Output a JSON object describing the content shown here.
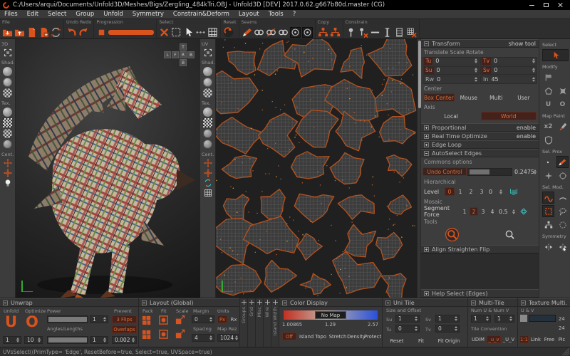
{
  "window": {
    "title": "C:/Users/arqui/Documents/Unfold3D/Meshes/Bigs/Zergling_484kTri.OBJ - Unfold3D [DEV] 2017.0.62.g667b80d.master (CG)"
  },
  "menu": {
    "items": [
      "Files",
      "Edit",
      "Select",
      "Group",
      "Unfold",
      "Symmetry",
      "Constrain&Deform",
      "Layout",
      "Tools",
      "?"
    ]
  },
  "toolbar": {
    "file": "File",
    "undo_redo": "Undo Redo",
    "progression": "Progression",
    "select": "Select",
    "reset": "Reset",
    "seams": "Seams",
    "copy": "Copy",
    "constrain": "Constrain"
  },
  "v3d": {
    "label": "3D",
    "shad": "Shad.",
    "tex": "Tex.",
    "cent": "Cent.",
    "nav": {
      "top": "T",
      "row": [
        "L",
        "F",
        "R",
        "B"
      ],
      "bottom": "B"
    }
  },
  "vuv": {
    "label": "UV",
    "shad": "Shad.",
    "tex": "Tex.",
    "cent": "Cent."
  },
  "rp": {
    "transform": {
      "title": "Transform",
      "show_tool": "show tool",
      "subtitle": "Translate Scale Rotate",
      "fields": [
        {
          "label": "Tu",
          "value": "0"
        },
        {
          "label": "Tv",
          "value": "0"
        },
        {
          "label": "Su",
          "value": "0"
        },
        {
          "label": "Sv",
          "value": "0"
        },
        {
          "label": "Rw",
          "value": "0"
        },
        {
          "label": "In",
          "value": "45"
        }
      ],
      "center_label": "Center",
      "center_options": [
        "Box Center",
        "Mouse",
        "Multi",
        "User"
      ],
      "axis_label": "Axis",
      "axis_options": [
        "Local",
        "World"
      ]
    },
    "sections": {
      "proportional": {
        "title": "Proportional",
        "right": "enable"
      },
      "rto": {
        "title": "Real Time Optimize",
        "right": "enable"
      },
      "edge_loop": {
        "title": "Edge Loop"
      },
      "autoselect": {
        "title": "AutoSelect Edges"
      }
    },
    "auto": {
      "commons": "Commons options",
      "undo_control": "Undo Control",
      "undo_value": "0.2475",
      "hierarchical": "Hierarchical",
      "level_label": "Level",
      "levels": [
        "0",
        "1",
        "2",
        "3"
      ],
      "level_value": "0",
      "mosaic": "Mosaic",
      "segment_label": "Segment Force",
      "segments": [
        "1",
        "2",
        "3",
        "4"
      ],
      "segment_value": "0.5",
      "tools": "Tools"
    },
    "align_title": "Align Straighten Flip",
    "help_title": "Help Select (Edges)"
  },
  "rs": {
    "select": "Select",
    "modify": "Modify",
    "map_paint": "Map Paint",
    "x2": "x2",
    "sel_prox": "Sel. Prox",
    "sel_mod": "Sel. Mod.",
    "symmetry": "Symmetry",
    "u": "U",
    "o": "O"
  },
  "bp": {
    "unwrap": {
      "title": "Unwrap",
      "unfold": "Unfold",
      "optimize": "Optimize",
      "power": "Power",
      "prevent": "Prevent",
      "angles": "Angles/Lengths",
      "u": "U",
      "o": "O",
      "unfold_value": "1",
      "optimize_value": "10",
      "power_value": "1",
      "angles_value": "1",
      "flips": "3 Flips",
      "overlaps": "Overlaps",
      "prevent_value": "0.002"
    },
    "layout": {
      "title": "Layout (Global)",
      "pack": "Pack",
      "fit": "Fit",
      "scale": "Scale",
      "margin": "Margin",
      "spacing": "Spacing",
      "units": "Units",
      "map_rez": "Map Rez",
      "margin_value": "0",
      "spacing_value": "4",
      "units_options": [
        "Px",
        "Rx"
      ],
      "map_rez_value": "1024"
    },
    "tabs": [
      "Groups",
      "Grid",
      "Misc",
      "Wire",
      "Island Width"
    ],
    "color": {
      "title": "Color Display",
      "no_map": "No Map",
      "min": "1.00865",
      "mid": "1.29",
      "max": "2.57",
      "modes": [
        "Off",
        "Island Topo",
        "Stretch",
        "Density",
        "Protect"
      ]
    },
    "uni": {
      "title": "Uni Tile",
      "size_offset": "Size and Offset",
      "su": "Su",
      "su_v": "1",
      "sv": "Sv",
      "sv_v": "1",
      "tu": "Tu",
      "tu_v": "0",
      "tv": "Tv",
      "tv_v": "0",
      "buttons": [
        "Reset",
        "Fit",
        "Fit Origin"
      ]
    },
    "multi": {
      "title": "Multi-Tile",
      "num": "Num U & Num V",
      "u_v": "1",
      "v_v": "1",
      "conv": "Tile Convention",
      "options": [
        "UDIM",
        "_u_v",
        "_U_V"
      ]
    },
    "tex": {
      "title": "Texture Multi.",
      "uv": "U & V",
      "u_v": "24",
      "v_v": "24",
      "buttons": [
        "1:1",
        "Link",
        "Free",
        "Pic"
      ]
    }
  },
  "status": {
    "text": "UVsSelect((PrimType= 'Edge', ResetBefore=true, Select=true, UVSpace=true)"
  },
  "colors": {
    "accent": "#d9531e",
    "selected_bg": "#44221b",
    "teal": "#3ab8b8",
    "seam": "#b5521e"
  }
}
